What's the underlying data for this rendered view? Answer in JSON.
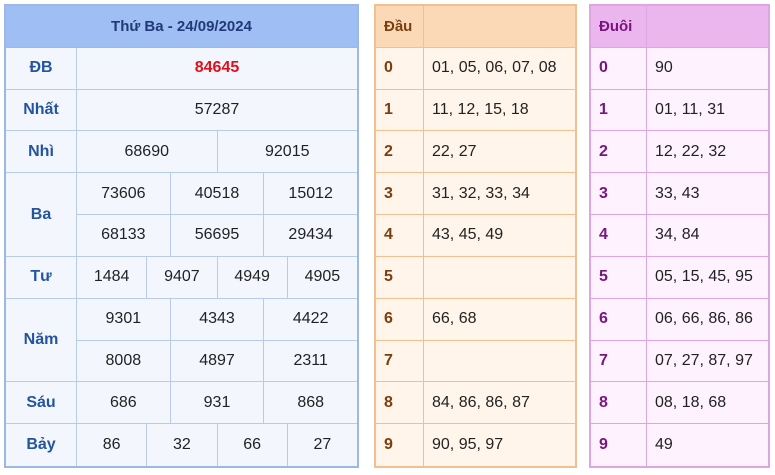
{
  "main": {
    "title": "Thứ Ba - 24/09/2024",
    "special": {
      "label": "ĐB",
      "values": [
        "84645"
      ]
    },
    "first": {
      "label": "Nhất",
      "values": [
        "57287"
      ]
    },
    "second": {
      "label": "Nhì",
      "values": [
        "68690",
        "92015"
      ]
    },
    "third": {
      "label": "Ba",
      "rows": [
        [
          "73606",
          "40518",
          "15012"
        ],
        [
          "68133",
          "56695",
          "29434"
        ]
      ]
    },
    "fourth": {
      "label": "Tư",
      "values": [
        "1484",
        "9407",
        "4949",
        "4905"
      ]
    },
    "fifth": {
      "label": "Năm",
      "rows": [
        [
          "9301",
          "4343",
          "4422"
        ],
        [
          "8008",
          "4897",
          "2311"
        ]
      ]
    },
    "sixth": {
      "label": "Sáu",
      "values": [
        "686",
        "931",
        "868"
      ]
    },
    "seventh": {
      "label": "Bảy",
      "values": [
        "86",
        "32",
        "66",
        "27"
      ]
    }
  },
  "dau": {
    "header": "Đầu",
    "rows": [
      {
        "key": "0",
        "value": "01, 05, 06, 07, 08"
      },
      {
        "key": "1",
        "value": "11, 12, 15, 18"
      },
      {
        "key": "2",
        "value": "22, 27"
      },
      {
        "key": "3",
        "value": "31, 32, 33, 34"
      },
      {
        "key": "4",
        "value": "43, 45, 49"
      },
      {
        "key": "5",
        "value": ""
      },
      {
        "key": "6",
        "value": "66, 68"
      },
      {
        "key": "7",
        "value": ""
      },
      {
        "key": "8",
        "value": "84, 86, 86, 87"
      },
      {
        "key": "9",
        "value": "90, 95, 97"
      }
    ]
  },
  "duoi": {
    "header": "Đuôi",
    "rows": [
      {
        "key": "0",
        "value": "90"
      },
      {
        "key": "1",
        "value": "01, 11, 31"
      },
      {
        "key": "2",
        "value": "12, 22, 32"
      },
      {
        "key": "3",
        "value": "33, 43"
      },
      {
        "key": "4",
        "value": "34, 84"
      },
      {
        "key": "5",
        "value": "05, 15, 45, 95"
      },
      {
        "key": "6",
        "value": "06, 66, 86, 86"
      },
      {
        "key": "7",
        "value": "07, 27, 87, 97"
      },
      {
        "key": "8",
        "value": "08, 18, 68"
      },
      {
        "key": "9",
        "value": "49"
      }
    ]
  },
  "colors": {
    "special_value": "#e0101b",
    "main_header_bg": "#9fbef3",
    "dau_header_bg": "#fbd9b6",
    "duoi_header_bg": "#ebb5ee"
  }
}
